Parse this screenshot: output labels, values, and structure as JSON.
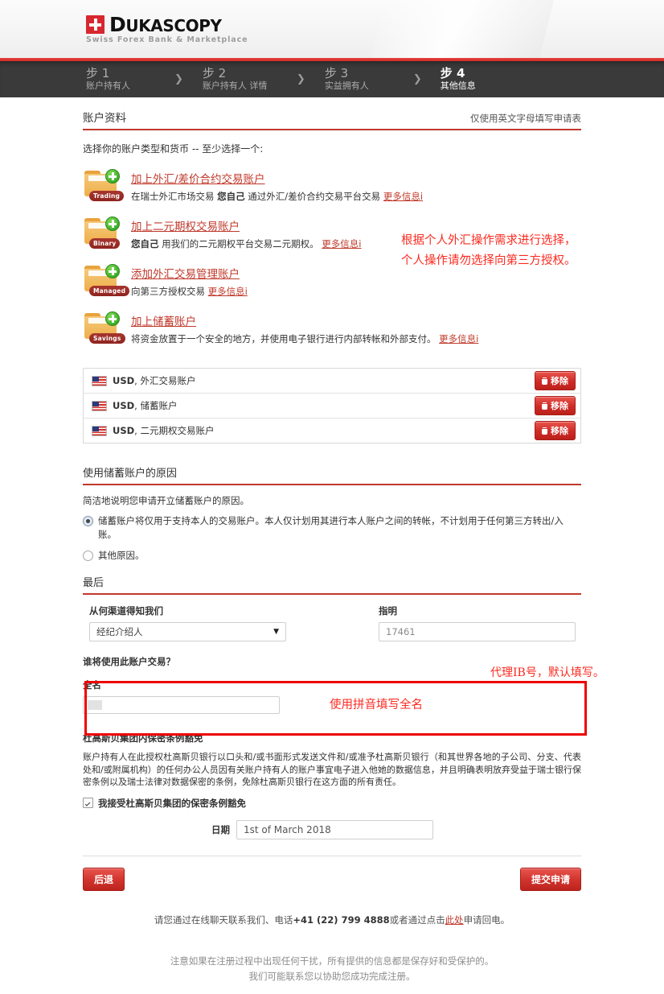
{
  "brand": {
    "name_part1": "D",
    "name_part2": "UKASCOPY",
    "tagline": "Swiss Forex Bank & Marketplace"
  },
  "steps": [
    {
      "num": "步 1",
      "label": "账户持有人",
      "active": false
    },
    {
      "num": "步 2",
      "label": "账户持有人 详情",
      "active": false
    },
    {
      "num": "步 3",
      "label": "实益拥有人",
      "active": false
    },
    {
      "num": "步 4",
      "label": "其他信息",
      "active": true
    }
  ],
  "section": {
    "title": "账户资料",
    "note": "仅使用英文字母填写申请表",
    "lead": "选择你的账户类型和货币 -- 至少选择一个:"
  },
  "account_types": [
    {
      "badge": "Trading",
      "title": "加上外汇/差价合约交易账户",
      "desc_before": "在瑞士外汇市场交易 ",
      "desc_bold": "您自己",
      "desc_after": " 通过外汇/差价合约交易平台交易 ",
      "more": "更多信息i"
    },
    {
      "badge": "Binary",
      "title": "加上二元期权交易账户",
      "desc_before": "",
      "desc_bold": "您自己",
      "desc_after": " 用我们的二元期权平台交易二元期权。 ",
      "more": "更多信息i"
    },
    {
      "badge": "Managed",
      "title": "添加外汇交易管理账户",
      "desc_before": "向第三方授权交易 ",
      "desc_bold": "",
      "desc_after": "",
      "more": "更多信息i"
    },
    {
      "badge": "Savings",
      "title": "加上储蓄账户",
      "desc_before": "将资金放置于一个安全的地方，并使用电子银行进行内部转帐和外部支付。 ",
      "desc_bold": "",
      "desc_after": "",
      "more": "更多信息i"
    }
  ],
  "selected_accounts": [
    {
      "currency": "USD",
      "type": "外汇交易账户",
      "remove_label": "移除"
    },
    {
      "currency": "USD",
      "type": "储蓄账户",
      "remove_label": "移除"
    },
    {
      "currency": "USD",
      "type": "二元期权交易账户",
      "remove_label": "移除"
    }
  ],
  "savings_reason": {
    "heading": "使用储蓄账户的原因",
    "intro": "简洁地说明您申请开立储蓄账户的原因。",
    "option1": "储蓄账户将仅用于支持本人的交易账户。本人仅计划用其进行本人账户之间的转帐，不计划用于任何第三方转出/入账。",
    "option2": "其他原因。"
  },
  "last": {
    "heading": "最后",
    "referral_label": "从何渠道得知我们",
    "referral_value": "经纪介绍人",
    "specify_label": "指明",
    "specify_value": "17461",
    "who_trades_label": "谁将使用此账户交易？",
    "fullname_label": "全名",
    "fullname_value": ""
  },
  "waiver": {
    "heading": "杜高斯贝集团内保密条例豁免",
    "paragraph": "账户持有人在此授权杜高斯贝银行以口头和/或书面形式发送文件和/或准予杜高斯贝银行（和其世界各地的子公司、分支、代表处和/或附属机构）的任何办公人员因有关账户持有人的账户事宜电子进入他她的数据信息，并且明确表明放弃受益于瑞士银行保密条例以及瑞士法律对数据保密的条例，免除杜高斯贝银行在这方面的所有责任。",
    "accept_label": "我接受杜高斯贝集团的保密条例豁免",
    "date_label": "日期",
    "date_value": "1st of March 2018"
  },
  "buttons": {
    "back": "后退",
    "submit": "提交申请"
  },
  "footer": {
    "line1_a": "请您通过在线聊天联系我们、电话",
    "line1_phone": "+41 (22) 799 4888",
    "line1_b": "或者通过点击",
    "line1_link": "此处",
    "line1_c": "申请回电。",
    "line2": "注意如果在注册过程中出现任何干扰，所有提供的信息都是保存好和受保护的。",
    "line3": "我们可能联系您以协助您成功完成注册。"
  },
  "annotations": {
    "note1_line1": "根据个人外汇操作需求进行选择，",
    "note1_line2": "个人操作请勿选择向第三方授权。",
    "note2": "代理IB号，默认填写。",
    "note3": "使用拼音填写全名"
  },
  "colors": {
    "brand_red": "#cf2b26",
    "annotation_red": "#fb2a20",
    "steps_bg": "#3a3a3a",
    "folder_orange": "#eeae4a"
  }
}
